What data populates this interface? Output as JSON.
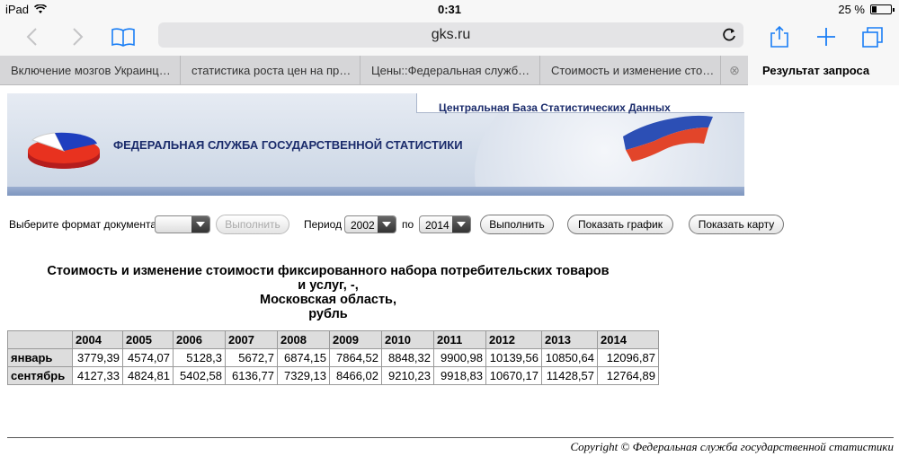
{
  "status_bar": {
    "device": "iPad",
    "time": "0:31",
    "battery_percent": "25 %",
    "battery_level": 0.25
  },
  "browser": {
    "url": "gks.ru",
    "tabs": [
      "Включение мозгов Украинц…",
      "статистика роста цен на пр…",
      "Цены::Федеральная служб…",
      "Стоимость и изменение сто…"
    ],
    "active_tab": "Результат запроса"
  },
  "banner": {
    "db_title": "Центральная База Статистических Данных",
    "org_title": "ФЕДЕРАЛЬНАЯ СЛУЖБА ГОСУДАРСТВЕННОЙ СТАТИСТИКИ"
  },
  "controls": {
    "format_label": "Выберите формат документа",
    "format_value": "",
    "run_disabled": "Выполнить",
    "period_label": "Период",
    "from_year": "2002",
    "to_label": "по",
    "to_year": "2014",
    "run": "Выполнить",
    "show_chart": "Показать график",
    "show_map": "Показать карту"
  },
  "report": {
    "title_lines": [
      "Стоимость и изменение стоимости фиксированного набора потребительских товаров",
      "и услуг, -,",
      "Московская область,",
      "рубль"
    ],
    "years": [
      "2004",
      "2005",
      "2006",
      "2007",
      "2008",
      "2009",
      "2010",
      "2011",
      "2012",
      "2013",
      "2014"
    ],
    "rows": [
      {
        "label": "январь",
        "values": [
          "3779,39",
          "4574,07",
          "5128,3",
          "5672,7",
          "6874,15",
          "7864,52",
          "8848,32",
          "9900,98",
          "10139,56",
          "10850,64",
          "12096,87"
        ]
      },
      {
        "label": "сентябрь",
        "values": [
          "4127,33",
          "4824,81",
          "5402,58",
          "6136,77",
          "7329,13",
          "8466,02",
          "9210,23",
          "9918,83",
          "10670,17",
          "11428,57",
          "12764,89"
        ]
      }
    ]
  },
  "footer": {
    "copyright": "Copyright © Федеральная служба государственной статистики"
  },
  "colors": {
    "banner_text": "#1a2b6b",
    "ios_blue": "#1a7ef5"
  }
}
